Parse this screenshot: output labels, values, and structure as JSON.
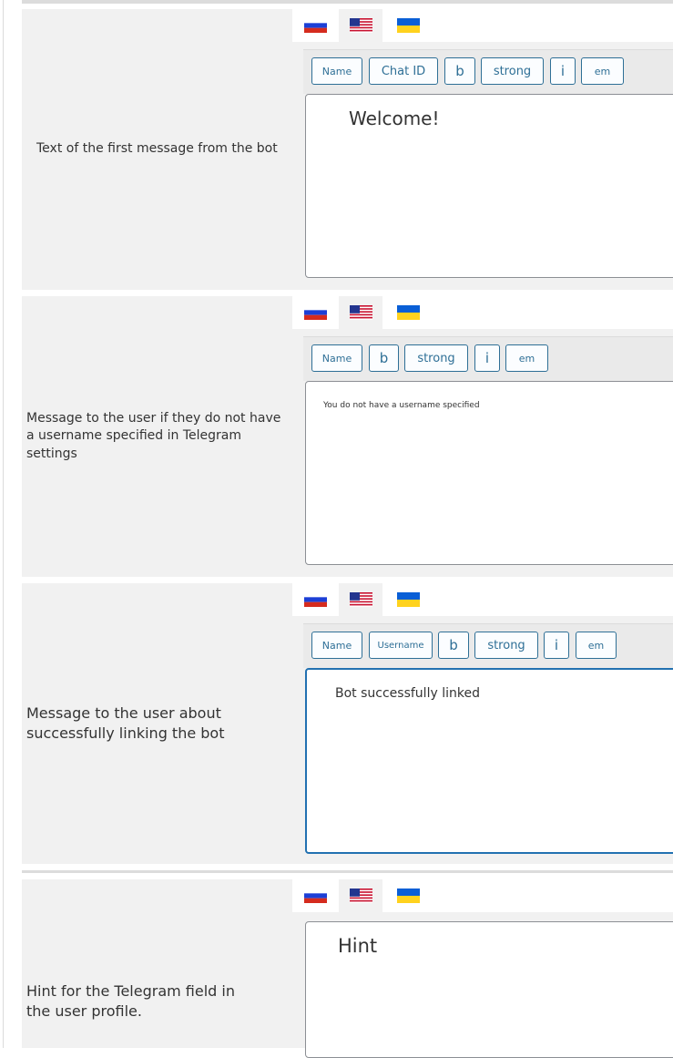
{
  "flags": {
    "ru": "RU",
    "en": "US",
    "ua": "UA"
  },
  "colors": {
    "accent": "#2e6f96",
    "focus": "#2271b1",
    "label_bg": "#f1f1f1"
  },
  "fields": [
    {
      "label": "Text of the first message from the bot",
      "buttons": [
        "Name",
        "Chat ID",
        "b",
        "strong",
        "i",
        "em"
      ],
      "content": "Welcome!"
    },
    {
      "label": "Message to the user if they do not have a username specified in Telegram settings",
      "buttons": [
        "Name",
        "b",
        "strong",
        "i",
        "em"
      ],
      "content": "You do not have a username specified"
    },
    {
      "label": "Message to the user about successfully linking the bot",
      "buttons": [
        "Name",
        "Username",
        "b",
        "strong",
        "i",
        "em"
      ],
      "content": "Bot successfully linked"
    },
    {
      "label": "Hint for the Telegram field in the user profile.",
      "buttons": [],
      "content": "Hint"
    }
  ]
}
